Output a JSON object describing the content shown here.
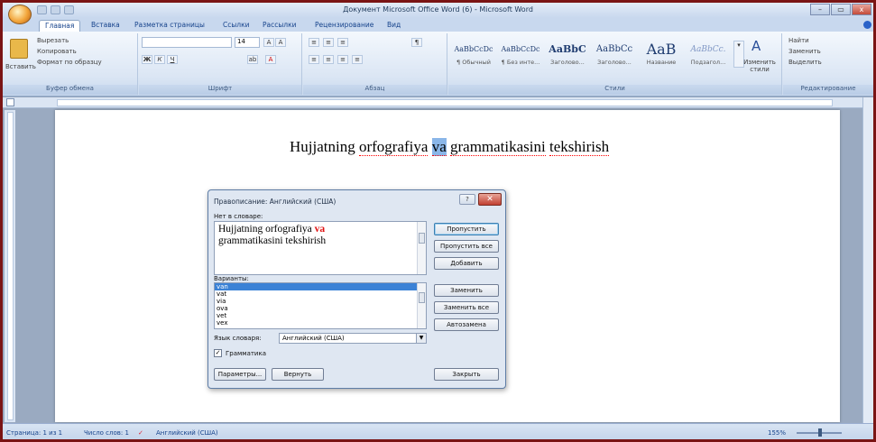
{
  "window": {
    "title": "Документ Microsoft Office Word (6) - Microsoft Word",
    "controls": [
      "–",
      "▭",
      "x"
    ]
  },
  "tabs": [
    "Главная",
    "Вставка",
    "Разметка страницы",
    "Ссылки",
    "Рассылки",
    "Рецензирование",
    "Вид"
  ],
  "clipboard": {
    "paste": "Вставить",
    "cut": "Вырезать",
    "copy": "Копировать",
    "format": "Формат по образцу",
    "label": "Буфер обмена"
  },
  "font": {
    "size": "14",
    "label": "Шрифт"
  },
  "paragraph": {
    "label": "Абзац"
  },
  "styles": {
    "items": [
      {
        "preview": "AaBbCcDc",
        "name": "¶ Обычный"
      },
      {
        "preview": "AaBbCcDc",
        "name": "¶ Без инте..."
      },
      {
        "preview": "AaBbC",
        "name": "Заголово..."
      },
      {
        "preview": "AaBbCc",
        "name": "Заголово..."
      },
      {
        "preview": "AaB",
        "name": "Название"
      },
      {
        "preview": "AaBbCc.",
        "name": "Подзагол..."
      }
    ],
    "change": "Изменить стили",
    "label": "Стили"
  },
  "editing": {
    "find": "Найти",
    "replace": "Заменить",
    "select": "Выделить",
    "label": "Редактирование"
  },
  "document": {
    "before": "Hujjatning ",
    "w1": "orfografiya",
    "sp": " ",
    "w2": "va",
    "w3": "grammatikasini",
    "w4": "tekshirish"
  },
  "dialog": {
    "title": "Правописание: Английский (США)",
    "help": "?",
    "not_in_dict_label": "Нет в словаре:",
    "text_before": "Hujjatning orfografiya",
    "error_word": "va",
    "text_after": "grammatikasini tekshirish",
    "suggestions_label": "Варианты:",
    "suggestions": [
      "van",
      "vat",
      "via",
      "ova",
      "vet",
      "vex"
    ],
    "dict_lang_label": "Язык словаря:",
    "dict_lang": "Английский (США)",
    "grammar_label": "Грамматика",
    "buttons": {
      "skip": "Пропустить",
      "skip_all": "Пропустить все",
      "add": "Добавить",
      "replace": "Заменить",
      "replace_all": "Заменить все",
      "autocorrect": "Автозамена",
      "options": "Параметры...",
      "undo": "Вернуть",
      "close": "Закрыть"
    }
  },
  "status": {
    "page": "Страница: 1 из 1",
    "words": "Число слов: 1",
    "lang": "Английский (США)",
    "zoom": "155%"
  }
}
